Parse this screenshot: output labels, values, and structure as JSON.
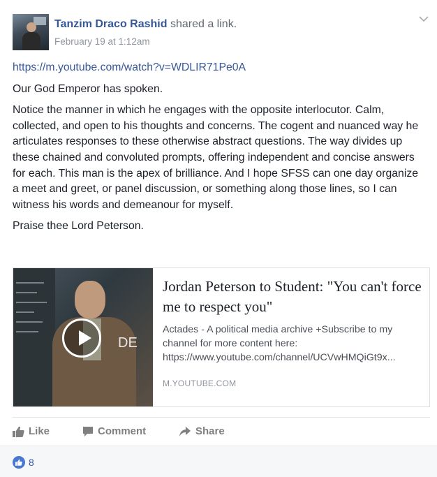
{
  "post": {
    "author": "Tanzim Draco Rashid",
    "action": "shared a link.",
    "timestamp": "February 19 at 1:12am",
    "link_url": "https://m.youtube.com/watch?v=WDLIR71Pe0A",
    "paragraphs": [
      "Our God Emperor has spoken.",
      "Notice the manner in which he engages with the opposite interlocutor. Calm, collected, and open to his thoughts and concerns. The cogent and nuanced way he articulates responses to these otherwise abstract questions. The way divides up these chained and convoluted prompts, offering independent and concise answers for each. This man is the apex of brilliance. And I hope SFSS can one day organize a meet and greet, or panel discussion, or something along those lines, so I can witness his words and demeanour for myself.",
      "Praise thee Lord Peterson."
    ]
  },
  "link_card": {
    "title": "Jordan Peterson to Student: \"You can't force me to respect you\"",
    "description_lines": [
      "Actades - A political media archive +Subscribe to my",
      "channel for more content here:",
      "https://www.youtube.com/channel/UCVwHMQiGt9x..."
    ],
    "domain": "M.YOUTUBE.COM",
    "thumbnail_wall_text": "DE"
  },
  "actions": {
    "like": "Like",
    "comment": "Comment",
    "share": "Share"
  },
  "reactions": {
    "count": "8"
  },
  "colors": {
    "link_blue": "#365899",
    "like_blue": "#4a76d4",
    "muted": "#90949c"
  },
  "icons": [
    "chevron-down-icon",
    "play-icon",
    "thumbs-up-icon",
    "comment-icon",
    "share-arrow-icon"
  ]
}
